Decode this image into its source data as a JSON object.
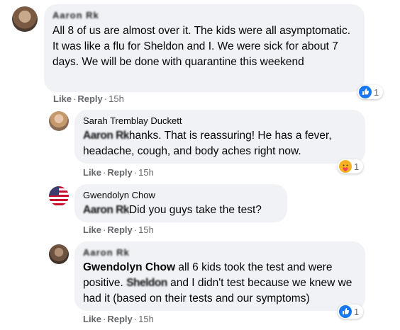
{
  "comments": [
    {
      "author": "Aaron Rk",
      "author_blurred": true,
      "text": "All 8 of us are almost over it. The kids were all asymptomatic. It was like a flu for Sheldon and I. We were sick for about 7 days. We will be done with quarantine this weekend",
      "like": "Like",
      "reply": "Reply",
      "time": "15h",
      "reaction": {
        "icon": "like-icon",
        "count": "1",
        "color": "#1877f2"
      }
    },
    {
      "author": "Sarah Tremblay Duckett",
      "tag_blurred": "Aaron Rk",
      "text": "hanks. That is reassuring! He has a fever, headache, cough, and body aches right now.",
      "like": "Like",
      "reply": "Reply",
      "time": "15h",
      "reaction": {
        "icon": "care-icon",
        "count": "1",
        "color": "#f7b125"
      }
    },
    {
      "author": "Gwendolyn Chow",
      "tag_blurred": "Aaron Rk",
      "text": "Did you guys take the test?",
      "like": "Like",
      "reply": "Reply",
      "time": "15h"
    },
    {
      "author": "Aaron Rk",
      "author_blurred": true,
      "mention": "Gwendolyn Chow",
      "text_a": "all 6 kids took the test and were positive.",
      "tag_blurred": "Sheldon",
      "text_b": "and I didn't test because we knew we had it (based on their tests and our symptoms)",
      "like": "Like",
      "reply": "Reply",
      "time": "15h",
      "reaction": {
        "icon": "like-icon",
        "count": "1",
        "color": "#1877f2"
      }
    }
  ],
  "separator": "·"
}
